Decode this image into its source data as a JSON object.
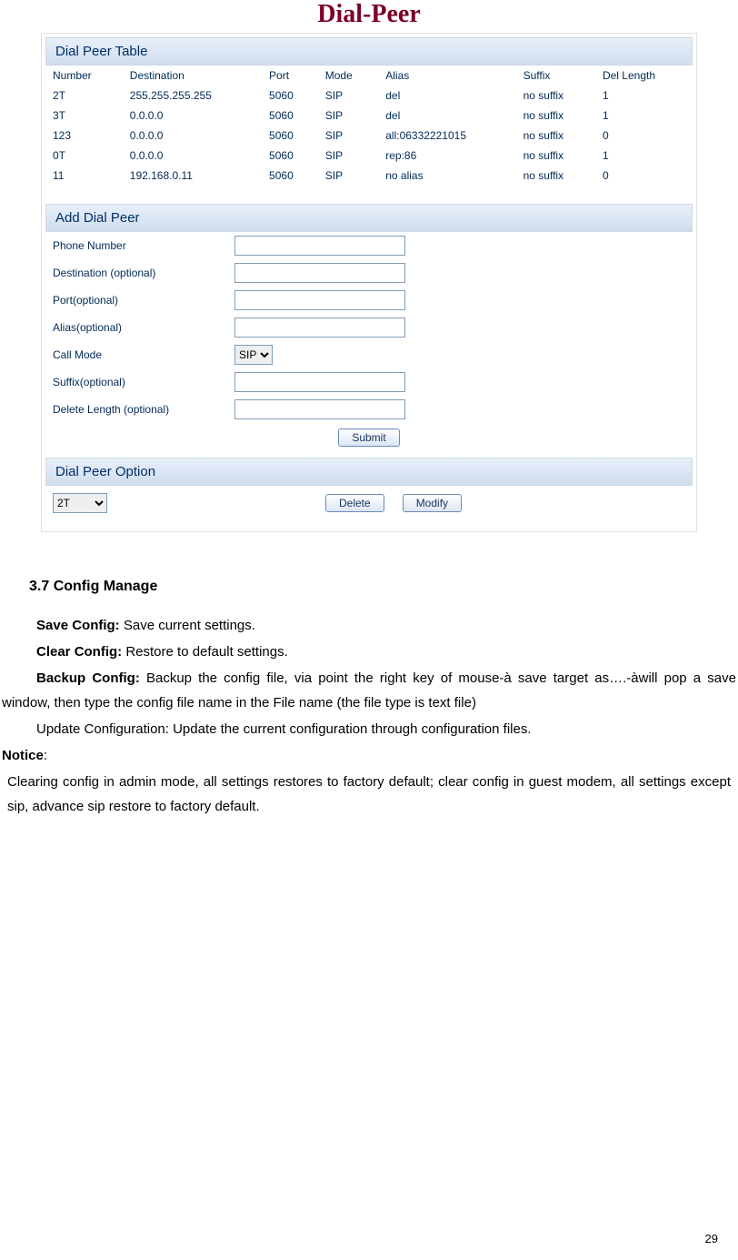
{
  "widget": {
    "title": "Dial-Peer",
    "table_section": "Dial Peer Table",
    "columns": [
      "Number",
      "Destination",
      "Port",
      "Mode",
      "Alias",
      "Suffix",
      "Del Length"
    ],
    "rows": [
      {
        "number": "2T",
        "dest": "255.255.255.255",
        "port": "5060",
        "mode": "SIP",
        "alias": "del",
        "suffix": "no suffix",
        "del": "1"
      },
      {
        "number": "3T",
        "dest": "0.0.0.0",
        "port": "5060",
        "mode": "SIP",
        "alias": "del",
        "suffix": "no suffix",
        "del": "1"
      },
      {
        "number": "123",
        "dest": "0.0.0.0",
        "port": "5060",
        "mode": "SIP",
        "alias": "all:06332221015",
        "suffix": "no suffix",
        "del": "0"
      },
      {
        "number": "0T",
        "dest": "0.0.0.0",
        "port": "5060",
        "mode": "SIP",
        "alias": "rep:86",
        "suffix": "no suffix",
        "del": "1"
      },
      {
        "number": "11",
        "dest": "192.168.0.11",
        "port": "5060",
        "mode": "SIP",
        "alias": "no alias",
        "suffix": "no suffix",
        "del": "0"
      }
    ],
    "add_section": "Add Dial Peer",
    "form": {
      "phone": "Phone Number",
      "dest": "Destination (optional)",
      "port": "Port(optional)",
      "alias": "Alias(optional)",
      "mode": "Call Mode",
      "mode_value": "SIP",
      "suffix": "Suffix(optional)",
      "dellen": "Delete Length (optional)",
      "submit": "Submit"
    },
    "option_section": "Dial Peer Option",
    "option": {
      "select_value": "2T",
      "delete": "Delete",
      "modify": "Modify"
    }
  },
  "doc": {
    "heading": "3.7 Config Manage",
    "save_label": "Save Config:",
    "save_text": " Save current settings.",
    "clear_label": "Clear Config:",
    "clear_text": " Restore to default settings.",
    "backup_label": "Backup Config:",
    "backup_text": " Backup the config file, via point the right key of mouse-à save target as….-àwill pop a save window, then type the config file name in the File name (the file type is text file)",
    "update_text": "Update Configuration: Update the current configuration through configuration files.",
    "notice_label": "Notice",
    "notice_colon": ":",
    "notice_text": "Clearing config in admin mode, all settings restores to factory default; clear config in guest modem, all settings except sip, advance sip restore to factory default."
  },
  "page_number": "29"
}
